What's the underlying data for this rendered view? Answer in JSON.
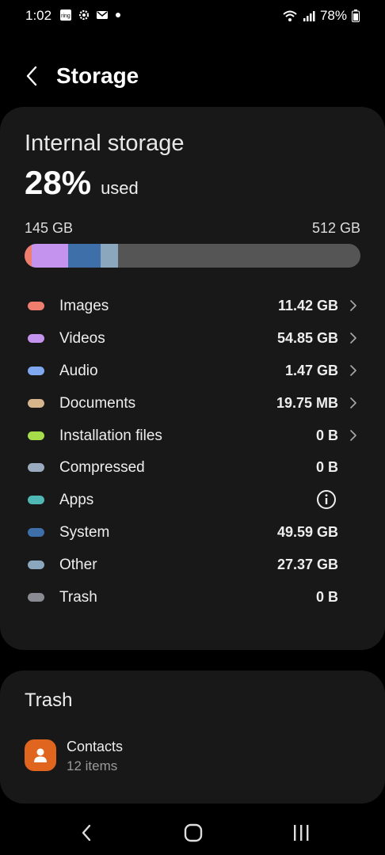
{
  "status_bar": {
    "time": "1:02",
    "battery_pct": "78%",
    "notification_icons": [
      "ring-icon",
      "gear-icon",
      "mail-icon",
      "dot-icon"
    ],
    "right_icons": [
      "wifi-icon",
      "signal-icon",
      "battery-icon"
    ]
  },
  "header": {
    "title": "Storage"
  },
  "storage": {
    "section_title": "Internal storage",
    "percent_used": "28%",
    "used_label": "used",
    "used_amount": "145 GB",
    "total_amount": "512 GB",
    "bar_segments": [
      {
        "name": "images",
        "color": "#ef7e6e",
        "fraction": 0.022
      },
      {
        "name": "videos",
        "color": "#c493ee",
        "fraction": 0.107
      },
      {
        "name": "system",
        "color": "#3f6fa8",
        "fraction": 0.097
      },
      {
        "name": "other",
        "color": "#8aa7bd",
        "fraction": 0.053
      }
    ],
    "categories": [
      {
        "label": "Images",
        "value": "11.42 GB",
        "color": "#ef7e6e",
        "chevron": true
      },
      {
        "label": "Videos",
        "value": "54.85 GB",
        "color": "#c493ee",
        "chevron": true
      },
      {
        "label": "Audio",
        "value": "1.47 GB",
        "color": "#7fa8f0",
        "chevron": true
      },
      {
        "label": "Documents",
        "value": "19.75 MB",
        "color": "#d6b48c",
        "chevron": true
      },
      {
        "label": "Installation files",
        "value": "0 B",
        "color": "#a6dc4a",
        "chevron": true
      },
      {
        "label": "Compressed",
        "value": "0 B",
        "color": "#9aabbf",
        "chevron": false
      },
      {
        "label": "Apps",
        "value": "",
        "color": "#4fb8b4",
        "chevron": false,
        "info": true
      },
      {
        "label": "System",
        "value": "49.59 GB",
        "color": "#3f6fa8",
        "chevron": false
      },
      {
        "label": "Other",
        "value": "27.37 GB",
        "color": "#8aa7bd",
        "chevron": false
      },
      {
        "label": "Trash",
        "value": "0 B",
        "color": "#8a8a92",
        "chevron": false
      }
    ]
  },
  "trash": {
    "title": "Trash",
    "items": [
      {
        "name": "Contacts",
        "count": "12 items",
        "icon": "contacts-icon",
        "color": "#e0651e"
      }
    ]
  },
  "nav_bar": {
    "buttons": [
      "back-icon",
      "home-icon",
      "recents-icon"
    ]
  }
}
